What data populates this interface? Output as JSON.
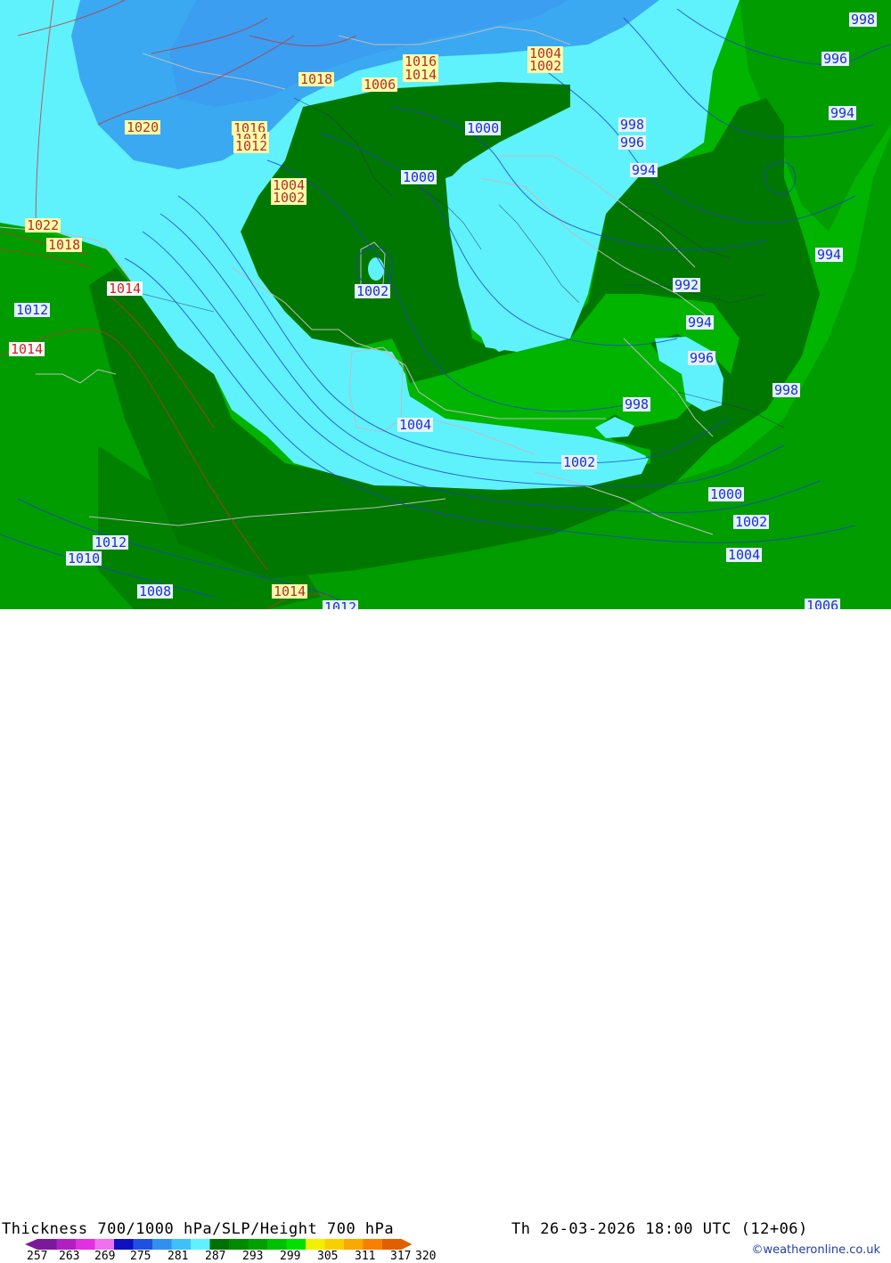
{
  "title": "Thickness 700/1000 hPa/SLP/Height 700 hPa",
  "valid_time": "Th 26-03-2026 18:00 UTC (12+06)",
  "credit": "©weatheronline.co.uk",
  "legend": {
    "ticks": [
      "257",
      "263",
      "269",
      "275",
      "281",
      "287",
      "293",
      "299",
      "305",
      "311",
      "317",
      "320"
    ],
    "colors": [
      "#7a1a9a",
      "#b020c0",
      "#e030e0",
      "#f070f0",
      "#1010c0",
      "#2050e0",
      "#3090f0",
      "#40c0f8",
      "#60f0ff",
      "#007000",
      "#008a00",
      "#00a000",
      "#00c000",
      "#00e000",
      "#f0f000",
      "#f8d000",
      "#f8a800",
      "#f88000",
      "#e06000"
    ]
  },
  "colors": {
    "light_cyan": "#5ff2fd",
    "sky_blue": "#3aa9f2",
    "mid_blue": "#3c9cf0",
    "dark_green": "#007700",
    "mid_green": "#00a100",
    "bright_green": "#00c000",
    "isobar_blue": "#2040c8",
    "isobar_red": "#c83030"
  },
  "isobar_labels": [
    {
      "text": "998",
      "style": "b"
    },
    {
      "text": "996",
      "style": "b"
    },
    {
      "text": "994",
      "style": "b"
    },
    {
      "text": "1020",
      "style": "y"
    },
    {
      "text": "1018",
      "style": "y"
    },
    {
      "text": "1016",
      "style": "y"
    },
    {
      "text": "1014",
      "style": "y"
    },
    {
      "text": "1012",
      "style": "y"
    },
    {
      "text": "1006",
      "style": "y"
    },
    {
      "text": "1016",
      "style": "y"
    },
    {
      "text": "1014",
      "style": "y"
    },
    {
      "text": "1004",
      "style": "y"
    },
    {
      "text": "1002",
      "style": "y"
    },
    {
      "text": "1000",
      "style": "b"
    },
    {
      "text": "1000",
      "style": "b"
    },
    {
      "text": "1004",
      "style": "y"
    },
    {
      "text": "1002",
      "style": "y"
    },
    {
      "text": "998",
      "style": "b"
    },
    {
      "text": "996",
      "style": "b"
    },
    {
      "text": "994",
      "style": "b"
    },
    {
      "text": "1022",
      "style": "y"
    },
    {
      "text": "1018",
      "style": "y"
    },
    {
      "text": "1014",
      "style": "r"
    },
    {
      "text": "1012",
      "style": "b"
    },
    {
      "text": "1014",
      "style": "r"
    },
    {
      "text": "1002",
      "style": "b"
    },
    {
      "text": "994",
      "style": "b"
    },
    {
      "text": "992",
      "style": "b"
    },
    {
      "text": "994",
      "style": "b"
    },
    {
      "text": "996",
      "style": "b"
    },
    {
      "text": "998",
      "style": "b"
    },
    {
      "text": "998",
      "style": "b"
    },
    {
      "text": "1004",
      "style": "b"
    },
    {
      "text": "1002",
      "style": "b"
    },
    {
      "text": "1000",
      "style": "b"
    },
    {
      "text": "1002",
      "style": "b"
    },
    {
      "text": "1004",
      "style": "b"
    },
    {
      "text": "1012",
      "style": "b"
    },
    {
      "text": "1010",
      "style": "b"
    },
    {
      "text": "1008",
      "style": "b"
    },
    {
      "text": "1014",
      "style": "y"
    },
    {
      "text": "1012",
      "style": "b"
    },
    {
      "text": "1006",
      "style": "b"
    }
  ]
}
